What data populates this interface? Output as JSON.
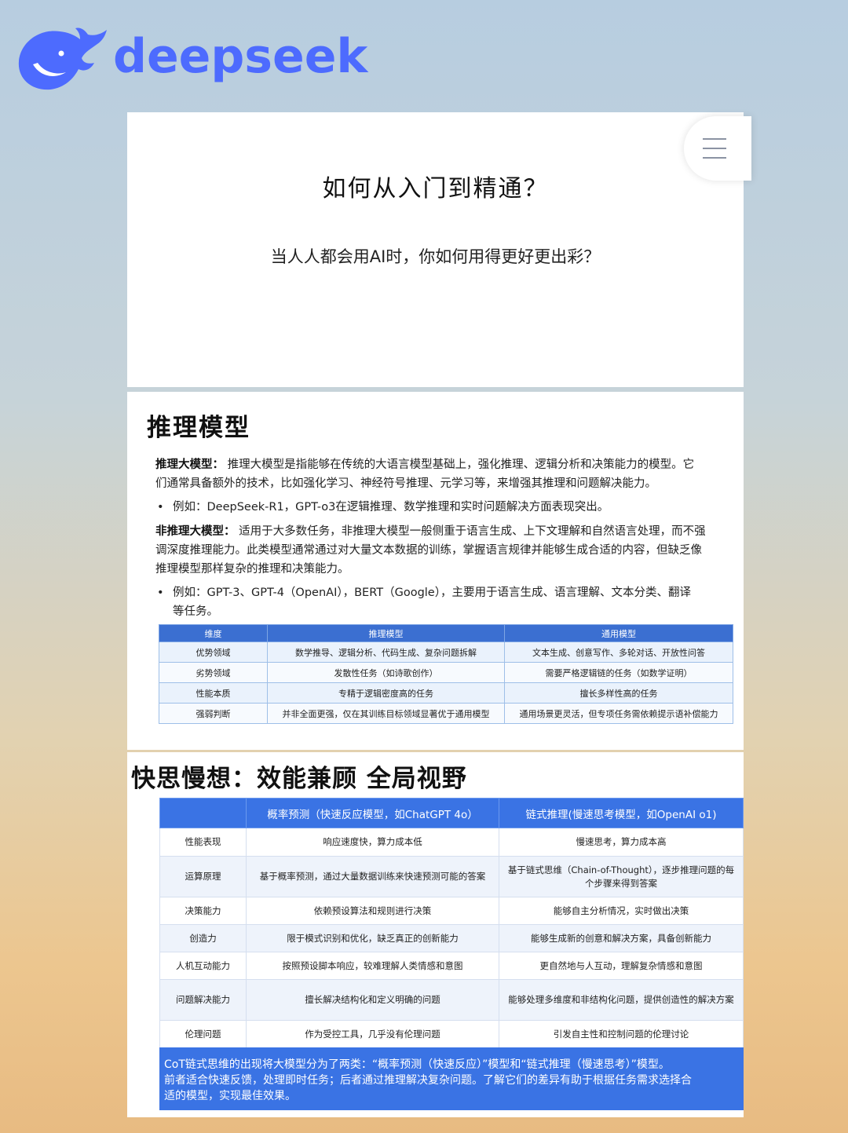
{
  "brand": {
    "name": "deepseek",
    "accent": "#4d6bfe",
    "logo_icon": "whale-icon"
  },
  "hero": {
    "title": "如何从入门到精通？",
    "subtitle": "当人人都会用AI时，你如何用得更好更出彩？",
    "menu_icon": "hamburger-menu-icon"
  },
  "section1": {
    "title": "推理模型",
    "p1_label": "推理大模型：",
    "p1_line1": "推理大模型是指能够在传统的大语言模型基础上，强化推理、逻辑分析和决策能力的模型。它",
    "p1_line2": "们通常具备额外的技术，比如强化学习、神经符号推理、元学习等，来增强其推理和问题解决能力。",
    "b1": "例如：DeepSeek-R1，GPT-o3在逻辑推理、数学推理和实时问题解决方面表现突出。",
    "p2_label": "非推理大模型：",
    "p2_line1": "适用于大多数任务，非推理大模型一般侧重于语言生成、上下文理解和自然语言处理，而不强",
    "p2_line2": "调深度推理能力。此类模型通常通过对大量文本数据的训练，掌握语言规律并能够生成合适的内容，但缺乏像",
    "p2_line3": "推理模型那样复杂的推理和决策能力。",
    "b2_line1": "例如：GPT-3、GPT-4（OpenAI），BERT（Google），主要用于语言生成、语言理解、文本分类、翻译",
    "b2_line2": "等任务。",
    "table": {
      "headers": [
        "维度",
        "推理模型",
        "通用模型"
      ],
      "rows": [
        [
          "优势领域",
          "数学推导、逻辑分析、代码生成、复杂问题拆解",
          "文本生成、创意写作、多轮对话、开放性问答"
        ],
        [
          "劣势领域",
          "发散性任务（如诗歌创作）",
          "需要严格逻辑链的任务（如数学证明）"
        ],
        [
          "性能本质",
          "专精于逻辑密度高的任务",
          "擅长多样性高的任务"
        ],
        [
          "强弱判断",
          "并非全面更强，仅在其训练目标领域显著优于通用模型",
          "通用场景更灵活，但专项任务需依赖提示语补偿能力"
        ]
      ]
    }
  },
  "section2": {
    "title": "快思慢想：效能兼顾 全局视野",
    "table": {
      "headers": [
        "",
        "概率预测（快速反应模型，如ChatGPT 4o）",
        "链式推理(慢速思考模型，如OpenAI o1)"
      ],
      "rows": [
        [
          "性能表现",
          "响应速度快，算力成本低",
          "慢速思考，算力成本高"
        ],
        [
          "运算原理",
          "基于概率预测，通过大量数据训练来快速预测可能的答案",
          "基于链式思维（Chain-of-Thought），逐步推理问题的每个步骤来得到答案"
        ],
        [
          "决策能力",
          "依赖预设算法和规则进行决策",
          "能够自主分析情况，实时做出决策"
        ],
        [
          "创造力",
          "限于模式识别和优化，缺乏真正的创新能力",
          "能够生成新的创意和解决方案，具备创新能力"
        ],
        [
          "人机互动能力",
          "按照预设脚本响应，较难理解人类情感和意图",
          "更自然地与人互动，理解复杂情感和意图"
        ],
        [
          "问题解决能力",
          "擅长解决结构化和定义明确的问题",
          "能够处理多维度和非结构化问题，提供创造性的解决方案"
        ],
        [
          "伦理问题",
          "作为受控工具，几乎没有伦理问题",
          "引发自主性和控制问题的伦理讨论"
        ]
      ]
    },
    "summary_line1": "CoT链式思维的出现将大模型分为了两类：“概率预测（快速反应）”模型和“链式推理（慢速思考）”模型。",
    "summary_line2": "前者适合快速反馈，处理即时任务；后者通过推理解决复杂问题。了解它们的差异有助于根据任务需求选择合",
    "summary_line3": "适的模型，实现最佳效果。"
  }
}
